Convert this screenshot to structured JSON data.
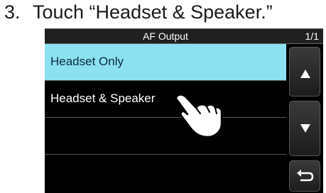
{
  "instruction": {
    "number": "3.",
    "text": "Touch “Headset & Speaker.”"
  },
  "screen": {
    "title": "AF Output",
    "page_indicator": "1/1",
    "items": [
      {
        "label": "Headset Only",
        "selected": true
      },
      {
        "label": "Headset & Speaker",
        "selected": false
      },
      {
        "label": "",
        "selected": false
      },
      {
        "label": "",
        "selected": false
      }
    ],
    "buttons": [
      {
        "icon": "triangle-up-icon"
      },
      {
        "icon": "triangle-down-icon"
      },
      {
        "icon": "return-arrow-icon"
      }
    ]
  },
  "overlay": {
    "icon": "pointing-hand-icon"
  }
}
